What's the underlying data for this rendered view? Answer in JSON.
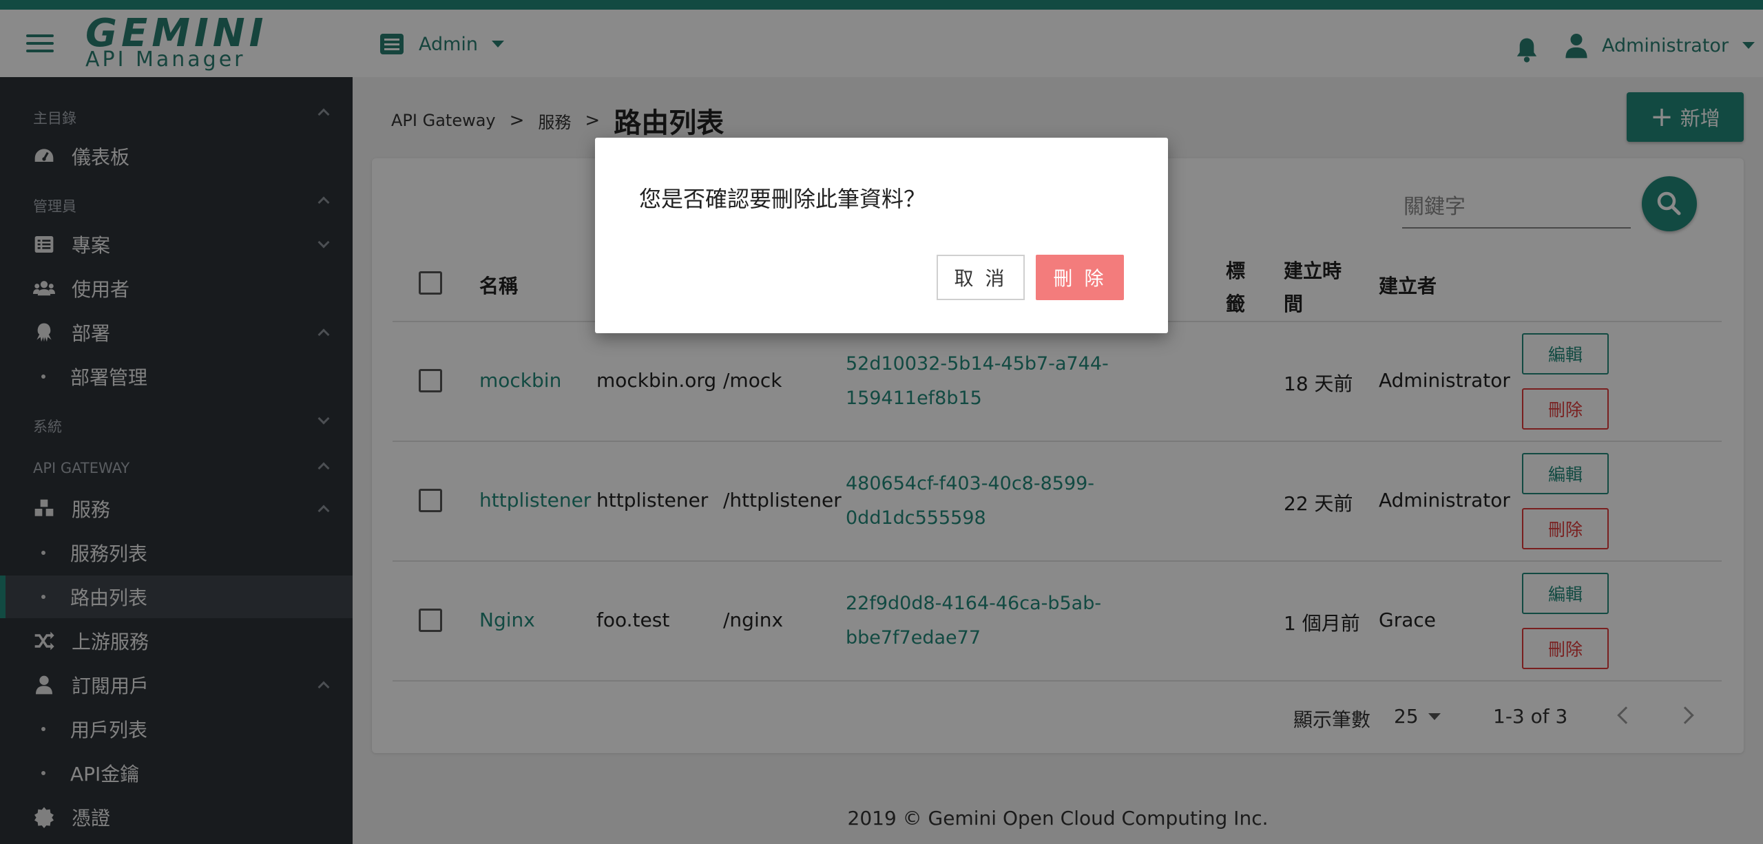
{
  "header": {
    "logo_top": "GEMINI",
    "logo_bottom": "API Manager",
    "project_selector": "Admin",
    "user_name": "Administrator"
  },
  "sidebar": {
    "section_main": "主目錄",
    "dashboard": "儀表板",
    "section_admin": "管理員",
    "projects": "專案",
    "users": "使用者",
    "departments": "部署",
    "department_mgmt": "部署管理",
    "section_system": "系統",
    "section_gateway": "API GATEWAY",
    "services": "服務",
    "service_list": "服務列表",
    "route_list": "路由列表",
    "upstream": "上游服務",
    "subscribers": "訂閱用戶",
    "subscriber_list": "用戶列表",
    "api_keys": "API金鑰",
    "credentials": "憑證"
  },
  "breadcrumb": {
    "level1": "API Gateway",
    "level2": "服務",
    "current": "路由列表",
    "separator": ">"
  },
  "toolbar": {
    "add_label": "新增",
    "search_placeholder": "關鍵字"
  },
  "table": {
    "headers": {
      "name": "名稱",
      "tags": "標籤",
      "created": "建立時間",
      "creator": "建立者"
    },
    "rows": [
      {
        "name": "mockbin",
        "host": "mockbin.org",
        "path": "/mock",
        "id_line1": "52d10032-5b14-45b7-a744-",
        "id_line2": "159411ef8b15",
        "created": "18 天前",
        "creator": "Administrator",
        "edit": "編輯",
        "delete": "刪除"
      },
      {
        "name": "httplistener",
        "host": "httplistener",
        "path": "/httplistener",
        "id_line1": "480654cf-f403-40c8-8599-",
        "id_line2": "0dd1dc555598",
        "created": "22 天前",
        "creator": "Administrator",
        "edit": "編輯",
        "delete": "刪除"
      },
      {
        "name": "Nginx",
        "host": "foo.test",
        "path": "/nginx",
        "id_line1": "22f9d0d8-4164-46ca-b5ab-",
        "id_line2": "bbe7f7edae77",
        "created": "1 個月前",
        "creator": "Grace",
        "edit": "編輯",
        "delete": "刪除"
      }
    ]
  },
  "pagination": {
    "rows_label": "顯示筆數",
    "rows_per_page": "25",
    "range": "1-3 of 3"
  },
  "footer": "2019 © Gemini Open Cloud Computing Inc.",
  "dialog": {
    "message": "您是否確認要刪除此筆資料？",
    "cancel": "取 消",
    "confirm": "刪 除"
  },
  "colors": {
    "brand": "#22897a",
    "sidebar_bg": "#2d3238",
    "danger": "#e03a3a",
    "danger_light": "#f37c7c"
  }
}
